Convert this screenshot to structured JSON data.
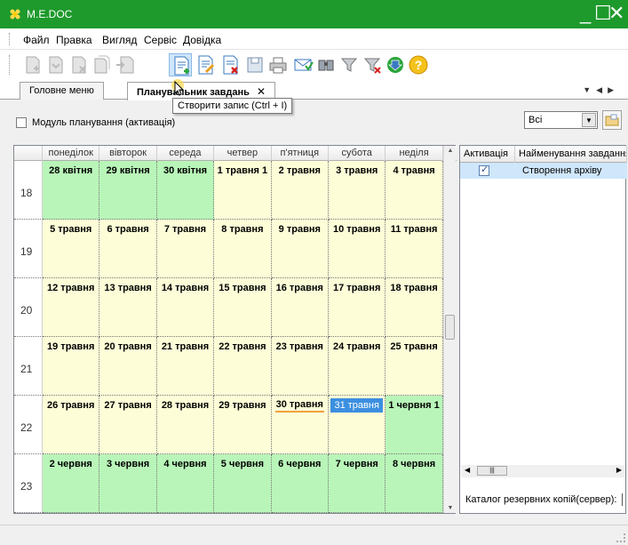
{
  "window": {
    "title": "M.E.DOC",
    "controls": [
      "_",
      "☐",
      "✕"
    ]
  },
  "menu": [
    "Файл",
    "Правка",
    "Вигляд",
    "Сервіс",
    "Довідка"
  ],
  "toolbar": {
    "tooltip": "Створити запис (Ctrl + I)"
  },
  "tabs": [
    {
      "label": "Головне меню"
    },
    {
      "label": "Планувальник завдань",
      "close": "✕"
    }
  ],
  "module": {
    "label": "Модуль планування (активація)"
  },
  "filter": {
    "value": "Всі"
  },
  "calendar": {
    "days": [
      "понеділок",
      "вівторок",
      "середа",
      "четвер",
      "п'ятниця",
      "субота",
      "неділя"
    ],
    "weeks": [
      {
        "number": "18",
        "cells": [
          "28 квітня",
          "29 квітня",
          "30 квітня",
          "1 травня 1",
          "2 травня",
          "3 травня",
          "4 травня"
        ],
        "colors": [
          "green",
          "green",
          "green",
          "yellow",
          "yellow",
          "yellow",
          "yellow"
        ]
      },
      {
        "number": "19",
        "cells": [
          "5 травня",
          "6 травня",
          "7 травня",
          "8 травня",
          "9 травня",
          "10 травня",
          "11 травня"
        ],
        "colors": [
          "yellow",
          "yellow",
          "yellow",
          "yellow",
          "yellow",
          "yellow",
          "yellow"
        ]
      },
      {
        "number": "20",
        "cells": [
          "12 травня",
          "13 травня",
          "14 травня",
          "15 травня",
          "16 травня",
          "17 травня",
          "18 травня"
        ],
        "colors": [
          "yellow",
          "yellow",
          "yellow",
          "yellow",
          "yellow",
          "yellow",
          "yellow"
        ]
      },
      {
        "number": "21",
        "cells": [
          "19 травня",
          "20 травня",
          "21 травня",
          "22 травня",
          "23 травня",
          "24 травня",
          "25 травня"
        ],
        "colors": [
          "yellow",
          "yellow",
          "yellow",
          "yellow",
          "yellow",
          "yellow",
          "yellow"
        ]
      },
      {
        "number": "22",
        "cells": [
          "26 травня",
          "27 травня",
          "28 травня",
          "29 травня",
          "30 травня",
          "31 травня",
          "1 червня 1"
        ],
        "colors": [
          "yellow",
          "yellow",
          "yellow",
          "yellow",
          "yellow",
          "yellow",
          "green"
        ]
      },
      {
        "number": "23",
        "cells": [
          "2 червня",
          "3 червня",
          "4 червня",
          "5 червня",
          "6 червня",
          "7 червня",
          "8 червня"
        ],
        "colors": [
          "green",
          "green",
          "green",
          "green",
          "green",
          "green",
          "green"
        ]
      }
    ],
    "today": "30 травня",
    "selected": "31 травня"
  },
  "tasks": {
    "columns": [
      "Активація",
      "Найменування завдання"
    ],
    "rows": [
      {
        "active": true,
        "name": "Створення архіву"
      }
    ],
    "footer_label": "Каталог резервних копій(сервер):"
  },
  "colors": {
    "titlebar": "#1e9a2c",
    "green_cell": "#b9f5b9",
    "yellow_cell": "#fdfdd8",
    "selected": "#3c8fe0"
  }
}
